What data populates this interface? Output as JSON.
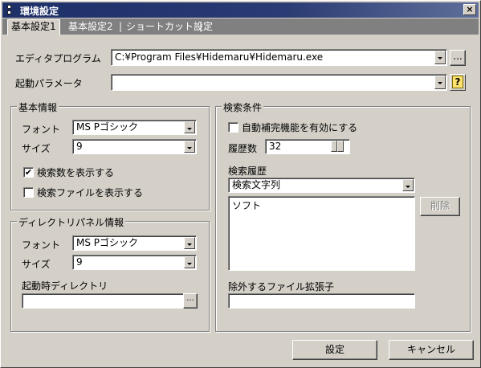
{
  "window": {
    "title": "環境設定",
    "close_label": "×"
  },
  "tabs": [
    {
      "label": "基本設定1"
    },
    {
      "label": "基本設定2"
    },
    {
      "label": "ショートカット設定"
    }
  ],
  "editor": {
    "label": "エディタプログラム",
    "value": "C:¥Program Files¥Hidemaru¥Hidemaru.exe",
    "browse_label": "..."
  },
  "params": {
    "label": "起動パラメータ",
    "value": "",
    "help_label": "?"
  },
  "basic_info": {
    "title": "基本情報",
    "font_label": "フォント",
    "font_value": "MS Pゴシック",
    "size_label": "サイズ",
    "size_value": "9",
    "show_count_label": "検索数を表示する",
    "show_count_checked": "✔",
    "show_files_label": "検索ファイルを表示する",
    "show_files_checked": ""
  },
  "dir_panel": {
    "title": "ディレクトリパネル情報",
    "font_label": "フォント",
    "font_value": "MS Pゴシック",
    "size_label": "サイズ",
    "size_value": "9",
    "startup_dir_label": "起動時ディレクトリ",
    "startup_dir_value": "",
    "browse_label": "..."
  },
  "search": {
    "title": "検索条件",
    "autocomplete_label": "自動補完機能を有効にする",
    "autocomplete_checked": "",
    "history_count_label": "履歴数",
    "history_count_value": "32",
    "history_label": "検索履歴",
    "history_type_value": "検索文字列",
    "history_items": [
      "ソフト"
    ],
    "delete_label": "削除",
    "exclude_ext_label": "除外するファイル拡張子",
    "exclude_ext_value": ""
  },
  "footer": {
    "ok_label": "設定",
    "cancel_label": "キャンセル"
  }
}
